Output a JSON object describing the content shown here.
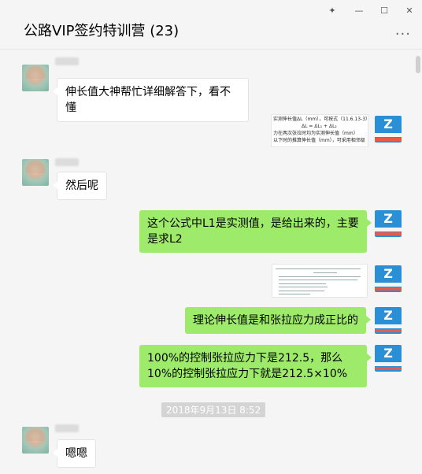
{
  "window": {
    "title": "公路VIP签约特训营 (23)",
    "pin_glyph": "𝄒",
    "min_glyph": "—",
    "max_glyph": "☐",
    "close_glyph": "✕",
    "more_glyph": "···"
  },
  "messages": [
    {
      "side": "in",
      "text": "伸长值大神帮忙详细解答下，看不懂"
    },
    {
      "side": "out_image",
      "lines": [
        "实测伸长值ΔL（mm），可按式（11.6.13-3）计算",
        "ΔL = ΔL₁ + ΔL₂",
        "力在两次张拉时均为实测伸长值（mm）",
        "以下时的推算伸长值（mm），可采用相邻级"
      ]
    },
    {
      "side": "in",
      "text": "然后呢"
    },
    {
      "side": "out",
      "text": "这个公式中L1是实测值，是给出来的，主要是求L2"
    },
    {
      "side": "out_image",
      "lines": []
    },
    {
      "side": "out",
      "text": "理论伸长值是和张拉应力成正比的"
    },
    {
      "side": "out",
      "text": "100%的控制张拉应力下是212.5，那么10%的控制张拉应力下就是212.5×10%"
    }
  ],
  "timestamp": "2018年9月13日 8:52",
  "last_message": {
    "side": "in",
    "text": "嗯嗯"
  },
  "icons": {
    "avatar": "user-avatar",
    "my_avatar": "company-logo-avatar"
  }
}
